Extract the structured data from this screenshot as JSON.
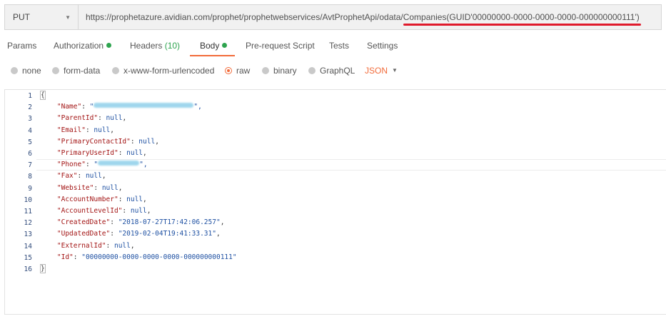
{
  "request": {
    "method": "PUT",
    "url_prefix": "https://prophetazure.avidian.com/prophet/prophetwebservices/AvtProphetApi/odata/",
    "url_highlight": "Companies(GUID'00000000-0000-0000-0000-000000000111')",
    "highlight_color": "#e01a2b"
  },
  "tabs": [
    {
      "label": "Params"
    },
    {
      "label": "Authorization",
      "dot": true
    },
    {
      "label": "Headers",
      "count": "(10)"
    },
    {
      "label": "Body",
      "dot": true,
      "active": true
    },
    {
      "label": "Pre-request Script"
    },
    {
      "label": "Tests"
    },
    {
      "label": "Settings"
    }
  ],
  "body_types": [
    {
      "label": "none"
    },
    {
      "label": "form-data"
    },
    {
      "label": "x-www-form-urlencoded"
    },
    {
      "label": "raw",
      "selected": true
    },
    {
      "label": "binary"
    },
    {
      "label": "GraphQL"
    }
  ],
  "format": "JSON",
  "colors": {
    "accent": "#f26b3a",
    "status_dot": "#2ea44f"
  },
  "editor": {
    "line_numbers": [
      "1",
      "2",
      "3",
      "4",
      "5",
      "6",
      "7",
      "8",
      "9",
      "10",
      "11",
      "12",
      "13",
      "14",
      "15",
      "16"
    ],
    "lines": [
      {
        "text": "{"
      },
      {
        "key": "\"Name\"",
        "value": "\"",
        "redacted": true,
        "tail": "\","
      },
      {
        "key": "\"ParentId\"",
        "value": "null",
        "tail": ","
      },
      {
        "key": "\"Email\"",
        "value": "null",
        "tail": ","
      },
      {
        "key": "\"PrimaryContactId\"",
        "value": "null",
        "tail": ","
      },
      {
        "key": "\"PrimaryUserId\"",
        "value": "null",
        "tail": ","
      },
      {
        "key": "\"Phone\"",
        "value": "\"",
        "redacted": true,
        "tail": "\","
      },
      {
        "key": "\"Fax\"",
        "value": "null",
        "tail": ","
      },
      {
        "key": "\"Website\"",
        "value": "null",
        "tail": ","
      },
      {
        "key": "\"AccountNumber\"",
        "value": "null",
        "tail": ","
      },
      {
        "key": "\"AccountLevelId\"",
        "value": "null",
        "tail": ","
      },
      {
        "key": "\"CreatedDate\"",
        "value": "\"2018-07-27T17:42:06.257\"",
        "tail": ","
      },
      {
        "key": "\"UpdatedDate\"",
        "value": "\"2019-02-04T19:41:33.31\"",
        "tail": ","
      },
      {
        "key": "\"ExternalId\"",
        "value": "null",
        "tail": ","
      },
      {
        "key": "\"Id\"",
        "value": "\"00000000-0000-0000-0000-000000000111\"",
        "tail": ""
      },
      {
        "text": "}"
      }
    ]
  }
}
